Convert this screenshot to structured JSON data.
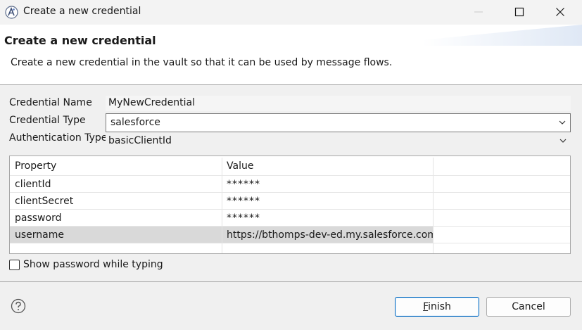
{
  "window": {
    "title": "Create a new credential",
    "icon": "app-logo-icon",
    "controls": [
      "minimize-icon",
      "maximize-icon",
      "close-icon"
    ]
  },
  "banner": {
    "title": "Create a new credential",
    "description": "Create a new credential in the vault so that it can be used by message flows."
  },
  "form": {
    "name_label": "Credential Name",
    "name_value": "MyNewCredential",
    "type_label": "Credential Type",
    "type_value": "salesforce",
    "auth_label": "Authentication Type",
    "auth_value": "basicClientId"
  },
  "table": {
    "columns": [
      "Property",
      "Value",
      ""
    ],
    "rows": [
      {
        "property": "clientId",
        "value": "******"
      },
      {
        "property": "clientSecret",
        "value": "******"
      },
      {
        "property": "password",
        "value": "******"
      },
      {
        "property": "username",
        "value": "https://bthomps-dev-ed.my.salesforce.com",
        "selected": true
      }
    ]
  },
  "show_password": {
    "label": "Show password while typing",
    "checked": false
  },
  "buttons": {
    "finish_mnemonic": "F",
    "finish_rest": "inish",
    "cancel": "Cancel",
    "help_icon": "help-icon"
  },
  "colors": {
    "accent": "#0067c0",
    "selected_row": "#d9d9d9",
    "banner_bg": "#ffffff",
    "dialog_bg": "#f0f0f0"
  }
}
